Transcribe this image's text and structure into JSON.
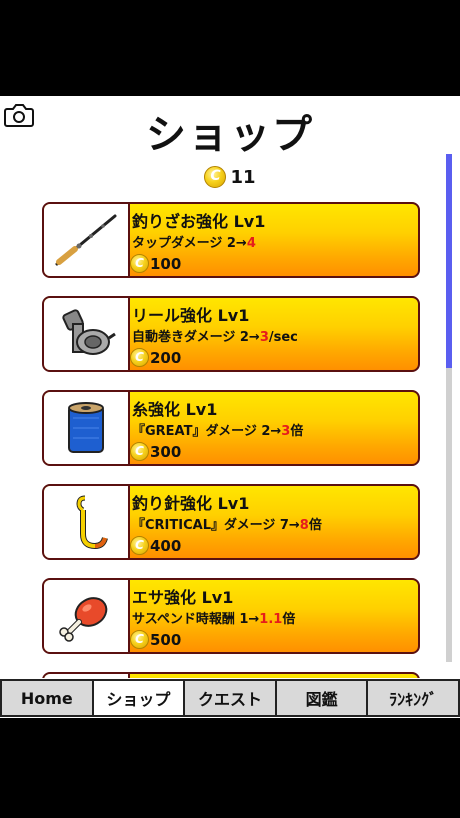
{
  "header": {
    "title": "ショップ",
    "coin_symbol": "C",
    "coin_count": "11"
  },
  "items": [
    {
      "name": "釣りざお強化  Lv1",
      "desc_pre": "タップダメージ  2→",
      "desc_val": "4",
      "desc_post": "",
      "price": "100",
      "icon": "fishing-rod-icon"
    },
    {
      "name": "リール強化  Lv1",
      "desc_pre": "自動巻きダメージ  2→",
      "desc_val": "3",
      "desc_post": "/sec",
      "price": "200",
      "icon": "reel-icon"
    },
    {
      "name": "糸強化  Lv1",
      "desc_pre": "『GREAT』ダメージ  2→",
      "desc_val": "3",
      "desc_post": "倍",
      "price": "300",
      "icon": "thread-spool-icon"
    },
    {
      "name": "釣り針強化  Lv1",
      "desc_pre": "『CRITICAL』ダメージ  7→",
      "desc_val": "8",
      "desc_post": "倍",
      "price": "400",
      "icon": "fish-hook-icon"
    },
    {
      "name": "エサ強化  Lv1",
      "desc_pre": "サスペンド時報酬  1→",
      "desc_val": "1.1",
      "desc_post": "倍",
      "price": "500",
      "icon": "bait-meat-icon"
    }
  ],
  "tabs": [
    {
      "label": "Home",
      "active": false
    },
    {
      "label": "ショップ",
      "active": true
    },
    {
      "label": "クエスト",
      "active": false
    },
    {
      "label": "図鑑",
      "active": false
    },
    {
      "label": "ﾗﾝｷﾝｸﾞ",
      "active": false
    }
  ],
  "colors": {
    "card_top": "#ffe600",
    "card_bottom": "#ff9000",
    "highlight": "#e51c1c",
    "scrollbar": "#5a5ef0"
  }
}
